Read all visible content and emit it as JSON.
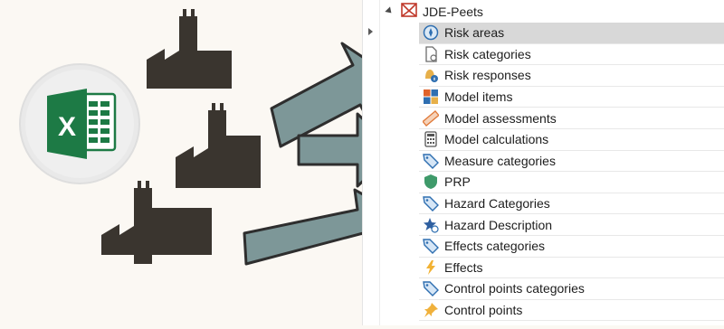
{
  "colors": {
    "background": "#fbf8f3",
    "factory": "#3a352f",
    "arrow": "#7d9798",
    "arrow_stroke": "#2e2e2e",
    "excel_green": "#1d7a45",
    "selected_row": "#d8d8d8"
  },
  "illustration": {
    "source_icon": "excel-icon",
    "source_letter": "X",
    "factories": [
      "factory-icon",
      "factory-icon",
      "factory-icon"
    ],
    "arrows": [
      "arrow-right-icon",
      "arrow-right-icon",
      "arrow-right-icon"
    ]
  },
  "tree": {
    "root": {
      "label": "JDE-Peets",
      "icon": "hierarchy-icon",
      "expanded": true
    },
    "items": [
      {
        "label": "Risk areas",
        "icon": "compass-icon",
        "selected": true
      },
      {
        "label": "Risk categories",
        "icon": "document-icon",
        "selected": false
      },
      {
        "label": "Risk responses",
        "icon": "bell-info-icon",
        "selected": false
      },
      {
        "label": "Model items",
        "icon": "tiles-icon",
        "selected": false
      },
      {
        "label": "Model assessments",
        "icon": "ruler-icon",
        "selected": false
      },
      {
        "label": "Model calculations",
        "icon": "calculator-icon",
        "selected": false
      },
      {
        "label": "Measure categories",
        "icon": "tag-icon",
        "selected": false
      },
      {
        "label": "PRP",
        "icon": "shield-icon",
        "selected": false
      },
      {
        "label": "Hazard Categories",
        "icon": "tag-icon",
        "selected": false
      },
      {
        "label": "Hazard Description",
        "icon": "star-icon",
        "selected": false
      },
      {
        "label": "Effects categories",
        "icon": "tag-icon",
        "selected": false
      },
      {
        "label": "Effects",
        "icon": "lightning-icon",
        "selected": false
      },
      {
        "label": "Control points categories",
        "icon": "tag-icon",
        "selected": false
      },
      {
        "label": "Control points",
        "icon": "pin-icon",
        "selected": false
      }
    ]
  }
}
